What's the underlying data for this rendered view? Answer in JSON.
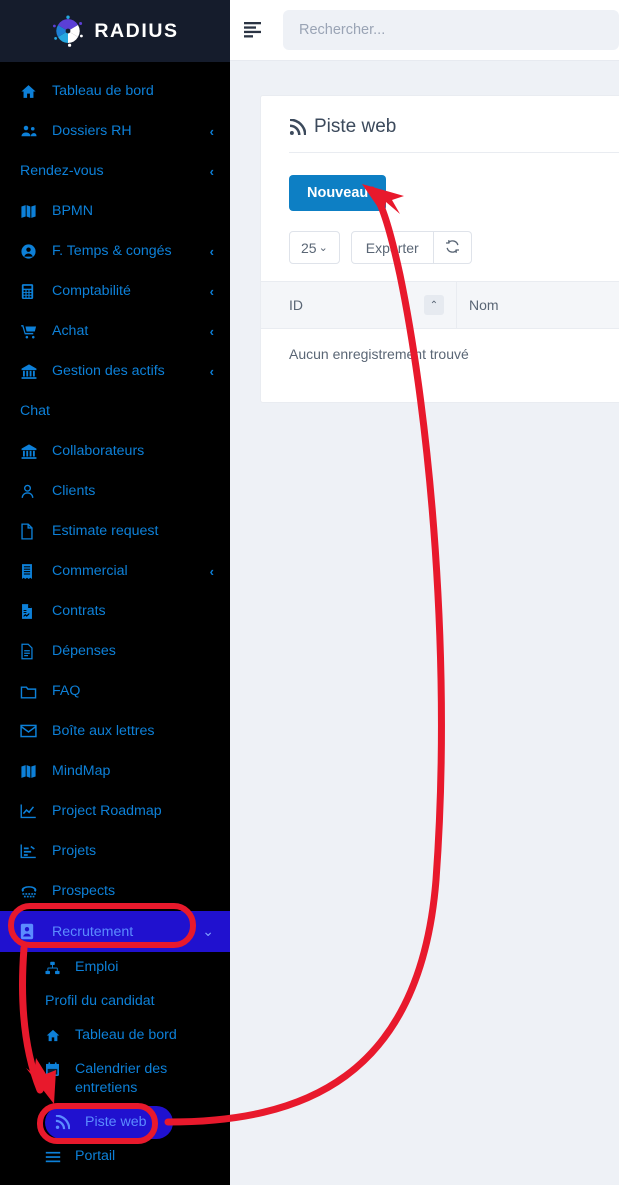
{
  "brand": {
    "name": "RADIUS",
    "logo_icon": "radius-pinwheel-logo"
  },
  "topbar": {
    "menu_icon": "hamburger-menu-icon",
    "search": {
      "placeholder": "Rechercher...",
      "value": ""
    }
  },
  "sidebar": {
    "items": [
      {
        "label": "Tableau de bord",
        "icon": "home-icon",
        "chevron": ""
      },
      {
        "label": "Dossiers RH",
        "icon": "users-icon",
        "chevron": "‹"
      },
      {
        "label": "Rendez-vous",
        "icon": "",
        "chevron": "‹"
      },
      {
        "label": "BPMN",
        "icon": "map-icon",
        "chevron": ""
      },
      {
        "label": "F. Temps & congés",
        "icon": "user-circle-icon",
        "chevron": "‹"
      },
      {
        "label": "Comptabilité",
        "icon": "calculator-icon",
        "chevron": "‹"
      },
      {
        "label": "Achat",
        "icon": "cart-icon",
        "chevron": "‹"
      },
      {
        "label": "Gestion des actifs",
        "icon": "bank-icon",
        "chevron": "‹"
      },
      {
        "label": "Chat",
        "icon": "",
        "chevron": ""
      },
      {
        "label": "Collaborateurs",
        "icon": "bank-icon",
        "chevron": ""
      },
      {
        "label": "Clients",
        "icon": "person-icon",
        "chevron": ""
      },
      {
        "label": "Estimate request",
        "icon": "file-icon",
        "chevron": ""
      },
      {
        "label": "Commercial",
        "icon": "receipt-icon",
        "chevron": "‹"
      },
      {
        "label": "Contrats",
        "icon": "contract-file-icon",
        "chevron": ""
      },
      {
        "label": "Dépenses",
        "icon": "document-lines-icon",
        "chevron": ""
      },
      {
        "label": "FAQ",
        "icon": "folder-icon",
        "chevron": ""
      },
      {
        "label": "Boîte aux lettres",
        "icon": "envelope-icon",
        "chevron": ""
      },
      {
        "label": "MindMap",
        "icon": "map-icon",
        "chevron": ""
      },
      {
        "label": "Project Roadmap",
        "icon": "chart-line-icon",
        "chevron": ""
      },
      {
        "label": "Projets",
        "icon": "project-chart-icon",
        "chevron": ""
      },
      {
        "label": "Prospects",
        "icon": "telephone-icon",
        "chevron": ""
      }
    ],
    "active_parent": {
      "label": "Recrutement",
      "icon": "id-badge-icon",
      "chevron": "⌄",
      "bg_color": "#2011cf",
      "text_color": "#5b8cff"
    },
    "submenu": [
      {
        "label": "Emploi",
        "icon": "sitemap-icon",
        "selected": false
      },
      {
        "label": "Profil du candidat",
        "icon": "",
        "selected": false
      },
      {
        "label": "Tableau de bord",
        "icon": "home-icon",
        "selected": false
      },
      {
        "label": "Calendrier des entretiens",
        "icon": "calendar-icon",
        "selected": false
      },
      {
        "label": "Piste web",
        "icon": "rss-icon",
        "selected": true
      },
      {
        "label": "Portail",
        "icon": "bars-icon",
        "selected": false
      }
    ]
  },
  "main": {
    "card": {
      "title": "Piste web",
      "title_icon": "rss-icon",
      "primary_button": "Nouveau",
      "toolbar": {
        "page_size": "25",
        "page_size_caret": "⌄",
        "export_label": "Exporter",
        "refresh_icon": "refresh-icon"
      },
      "table": {
        "columns": [
          "ID",
          "Nom"
        ],
        "sort_indicator": "⌃",
        "rows": [],
        "empty_message": "Aucun enregistrement trouvé"
      }
    }
  },
  "annotations": {
    "highlight_color": "#e8192c",
    "items": [
      {
        "name": "recrutement-highlight-box",
        "shape": "rounded-rect"
      },
      {
        "name": "piste-web-highlight-box",
        "shape": "rounded-rect"
      },
      {
        "name": "arrow-recrutement-to-piste-web",
        "shape": "arrow"
      },
      {
        "name": "arrow-piste-web-to-nouveau",
        "shape": "curved-arrow"
      }
    ]
  },
  "colors": {
    "sidebar_bg": "#000000",
    "brand_bg": "#151c2c",
    "nav_text": "#0d80d8",
    "accent_blue": "#0d7fc4",
    "page_bg": "#eef1f6",
    "annotation_red": "#e8192c"
  }
}
